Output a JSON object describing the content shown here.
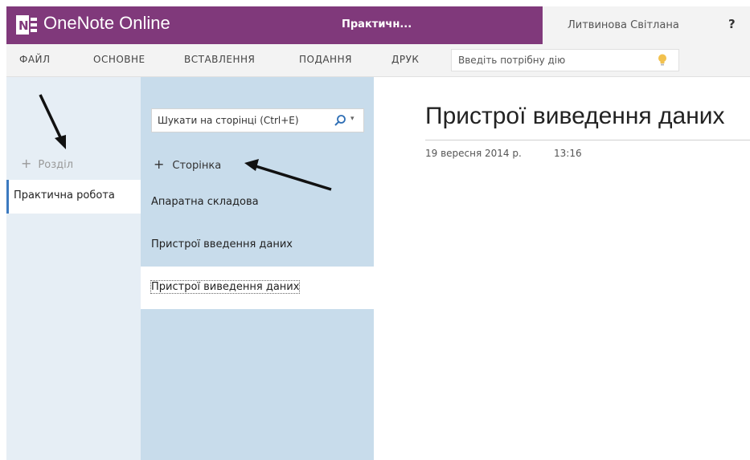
{
  "app": {
    "name": "OneNote Online",
    "document_title": "Практичн...",
    "user_name": "Литвинова Світлана",
    "help_label": "?"
  },
  "ribbon": {
    "tabs": [
      "ФАЙЛ",
      "ОСНОВНЕ",
      "ВСТАВЛЕННЯ",
      "ПОДАННЯ",
      "ДРУК"
    ],
    "tell_me_placeholder": "Введіть потрібну дію"
  },
  "sections": {
    "add_label": "Розділ",
    "items": [
      {
        "label": "Практична робота",
        "active": true
      }
    ]
  },
  "pages": {
    "search_placeholder": "Шукати на сторінці (Ctrl+E)",
    "add_label": "Сторінка",
    "items": [
      {
        "label": "Апаратна складова",
        "selected": false
      },
      {
        "label": "Пристрої введення даних",
        "selected": false
      },
      {
        "label": "Пристрої виведення даних",
        "selected": true
      }
    ]
  },
  "content": {
    "title": "Пристрої виведення даних",
    "date": "19 вересня 2014 р.",
    "time": "13:16"
  },
  "colors": {
    "brand": "#80397b",
    "section_accent": "#3c7ac0",
    "pages_pane": "#c8dceb",
    "sections_pane": "#e6eef5"
  },
  "icons": [
    "onenote-logo-icon",
    "search-icon",
    "lightbulb-icon",
    "plus-icon",
    "annotation-arrow-icon"
  ]
}
